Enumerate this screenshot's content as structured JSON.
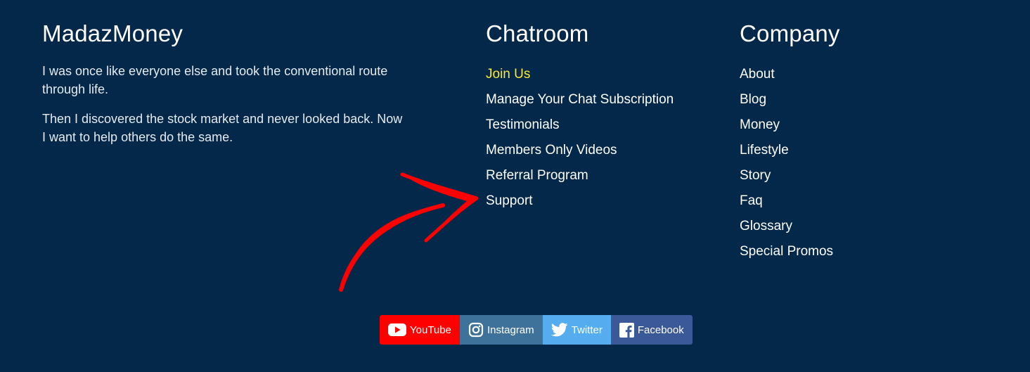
{
  "about": {
    "title": "MadazMoney",
    "paragraphs": [
      "I was once like everyone else and took the conventional route through life.",
      "Then I discovered the stock market and never looked back. Now I want to help others do the same."
    ]
  },
  "chatroom": {
    "title": "Chatroom",
    "links": [
      "Join Us",
      "Manage Your Chat Subscription",
      "Testimonials",
      "Members Only Videos",
      "Referral Program",
      "Support"
    ]
  },
  "company": {
    "title": "Company",
    "links": [
      "About",
      "Blog",
      "Money",
      "Lifestyle",
      "Story",
      "Faq",
      "Glossary",
      "Special Promos"
    ]
  },
  "social": [
    {
      "label": "YouTube",
      "icon": "youtube-icon",
      "color": "#fe0000"
    },
    {
      "label": "Instagram",
      "icon": "instagram-icon",
      "color": "#3f729b"
    },
    {
      "label": "Twitter",
      "icon": "twitter-icon",
      "color": "#55acee"
    },
    {
      "label": "Facebook",
      "icon": "facebook-icon",
      "color": "#3b5998"
    }
  ],
  "colors": {
    "background": "#03284a",
    "accent_link": "#f7e838",
    "annotation_arrow": "#ff0000"
  }
}
